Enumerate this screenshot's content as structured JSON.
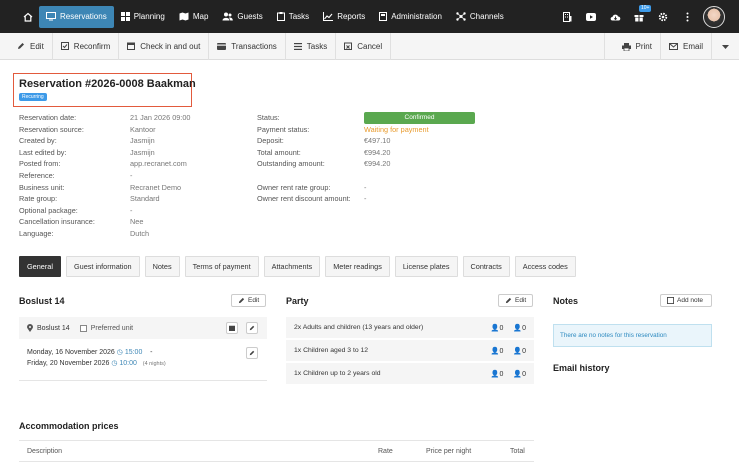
{
  "nav": {
    "items": [
      {
        "id": "reservations",
        "label": "Reservations",
        "icon": "monitor-icon",
        "active": true
      },
      {
        "id": "planning",
        "label": "Planning",
        "icon": "grid-icon"
      },
      {
        "id": "map",
        "label": "Map",
        "icon": "map-icon"
      },
      {
        "id": "guests",
        "label": "Guests",
        "icon": "users-icon"
      },
      {
        "id": "tasks",
        "label": "Tasks",
        "icon": "clipboard-icon"
      },
      {
        "id": "reports",
        "label": "Reports",
        "icon": "chart-icon"
      },
      {
        "id": "administration",
        "label": "Administration",
        "icon": "document-icon"
      },
      {
        "id": "channels",
        "label": "Channels",
        "icon": "network-icon"
      }
    ],
    "notification_count": "10+"
  },
  "toolbar": {
    "edit": "Edit",
    "reconfirm": "Reconfirm",
    "checkin": "Check in and out",
    "transactions": "Transactions",
    "tasks": "Tasks",
    "cancel": "Cancel",
    "print": "Print",
    "email": "Email"
  },
  "reservation": {
    "title": "Reservation #2026-0008 Baakman",
    "badge": "Recurring"
  },
  "details_left": [
    {
      "label": "Reservation date:",
      "value": "21 Jan 2026 09:00"
    },
    {
      "label": "Reservation source:",
      "value": "Kantoor"
    },
    {
      "label": "Created by:",
      "value": "Jasmijn"
    },
    {
      "label": "Last edited by:",
      "value": "Jasmijn"
    },
    {
      "label": "Posted from:",
      "value": "app.recranet.com"
    },
    {
      "label": "Reference:",
      "value": "-"
    },
    {
      "label": "Business unit:",
      "value": "Recranet Demo"
    },
    {
      "label": "Rate group:",
      "value": "Standard"
    },
    {
      "label": "Optional package:",
      "value": "-"
    },
    {
      "label": "Cancellation insurance:",
      "value": "Nee"
    },
    {
      "label": "Language:",
      "value": "Dutch"
    }
  ],
  "details_right": {
    "status_label": "Status:",
    "status_value": "Confirmed",
    "payment_label": "Payment status:",
    "payment_value": "Waiting for payment",
    "deposit_label": "Deposit:",
    "deposit_value": "€497.10",
    "total_label": "Total amount:",
    "total_value": "€994.20",
    "outstanding_label": "Outstanding amount:",
    "outstanding_value": "€994.20",
    "owner_rent_group_label": "Owner rent rate group:",
    "owner_rent_group_value": "-",
    "owner_rent_discount_label": "Owner rent discount amount:",
    "owner_rent_discount_value": "-"
  },
  "tabs": [
    "General",
    "Guest information",
    "Notes",
    "Terms of payment",
    "Attachments",
    "Meter readings",
    "License plates",
    "Contracts",
    "Access codes"
  ],
  "unit_section": {
    "title": "Boslust 14",
    "edit": "Edit",
    "unit_name": "Boslust 14",
    "preferred_label": "Preferred unit",
    "arrival_date": "Monday, 16 November 2026",
    "arrival_time": "15:00",
    "departure_date": "Friday, 20 November 2026",
    "departure_time": "10:00",
    "nights": "(4 nights)",
    "dash": "-"
  },
  "party": {
    "title": "Party",
    "edit": "Edit",
    "rows": [
      {
        "label": "2x Adults and children (13 years and older)",
        "a": "0",
        "b": "0"
      },
      {
        "label": "1x Children aged 3 to 12",
        "a": "0",
        "b": "0"
      },
      {
        "label": "1x Children up to 2 years old",
        "a": "0",
        "b": "0"
      }
    ]
  },
  "notes": {
    "title": "Notes",
    "add": "Add note",
    "empty": "There are no notes for this reservation",
    "email_history": "Email history"
  },
  "prices": {
    "title": "Accommodation prices",
    "col_description": "Description",
    "col_rate": "Rate",
    "col_price": "Price per night",
    "col_total": "Total"
  }
}
